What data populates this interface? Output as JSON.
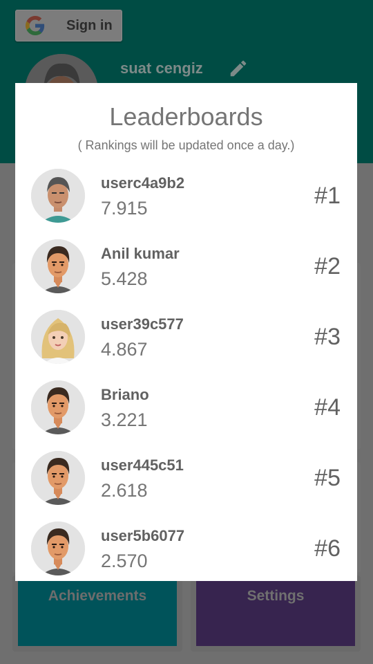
{
  "header": {
    "signin_label": "Sign in",
    "user_name": "suat cengiz"
  },
  "tiles": {
    "achievements": "Achievements",
    "settings": "Settings"
  },
  "dialog": {
    "title": "Leaderboards",
    "subtitle": "( Rankings will be updated once a day.)",
    "entries": [
      {
        "name": "userc4a9b2",
        "score": "7.915",
        "rank": "#1",
        "avatar": "man-grey-hair"
      },
      {
        "name": "Anil kumar",
        "score": "5.428",
        "rank": "#2",
        "avatar": "man-dark-hair"
      },
      {
        "name": "user39c577",
        "score": "4.867",
        "rank": "#3",
        "avatar": "woman-blonde"
      },
      {
        "name": "Briano",
        "score": "3.221",
        "rank": "#4",
        "avatar": "man-dark-hair"
      },
      {
        "name": "user445c51",
        "score": "2.618",
        "rank": "#5",
        "avatar": "man-dark-hair"
      },
      {
        "name": "user5b6077",
        "score": "2.570",
        "rank": "#6",
        "avatar": "man-dark-hair"
      }
    ]
  },
  "colors": {
    "header_bg": "#004c44",
    "overlay_bg": "#6f6f6f",
    "achievements_tile": "#00535a",
    "settings_tile": "#37244f",
    "dialog_bg": "#ffffff",
    "text_dark": "#616161"
  }
}
